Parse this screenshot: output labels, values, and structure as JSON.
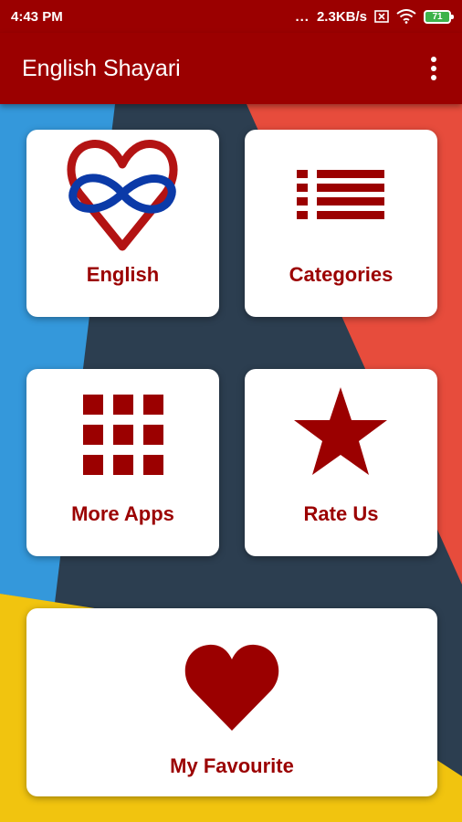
{
  "status": {
    "time": "4:43 PM",
    "dots": "...",
    "speed": "2.3KB/s",
    "battery": "71"
  },
  "app_bar": {
    "title": "English Shayari",
    "menu_icon": "more-vert-icon"
  },
  "colors": {
    "primary": "#9b0000",
    "bg_blue": "#3498db",
    "bg_dark": "#2c3e50",
    "bg_red": "#e74c3c",
    "bg_yellow": "#f1c40f"
  },
  "cards": {
    "english": {
      "label": "English",
      "icon": "infinity-heart-icon"
    },
    "categories": {
      "label": "Categories",
      "icon": "list-icon"
    },
    "more_apps": {
      "label": "More Apps",
      "icon": "grid-icon"
    },
    "rate_us": {
      "label": "Rate Us",
      "icon": "star-icon"
    },
    "favourite": {
      "label": "My Favourite",
      "icon": "heart-icon"
    }
  }
}
